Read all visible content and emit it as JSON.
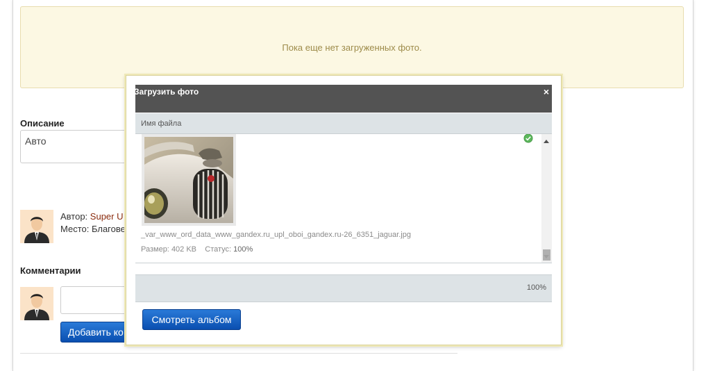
{
  "notice": {
    "text": "Пока еще нет загруженных фото."
  },
  "description": {
    "title": "Описание",
    "value": "Авто"
  },
  "author": {
    "author_label": "Автор:",
    "author_name": "Super U",
    "place_label": "Место:",
    "place_value": "Благове"
  },
  "comments": {
    "title": "Комментарии",
    "add_button": "Добавить ко"
  },
  "upload_modal": {
    "title": "Загрузить фото",
    "close_symbol": "×",
    "column_header": "Имя файла",
    "file": {
      "name": "_var_www_ord_data_www_gandex.ru_upl_oboi_gandex.ru-26_6351_jaguar.jpg",
      "size_label": "Размер:",
      "size_value": "402 KB",
      "status_label": "Статус:",
      "status_value": "100%",
      "progress": 1.0
    },
    "total_progress": "100%",
    "view_album_button": "Смотреть альбом"
  },
  "colors": {
    "notice_bg": "#fcf8e3",
    "modal_header": "#535353",
    "button_blue": "#1560c4",
    "success_green": "#5cb85c"
  },
  "icons": [
    "close-icon",
    "check-circle-icon",
    "scroll-up-icon",
    "scroll-down-icon"
  ]
}
